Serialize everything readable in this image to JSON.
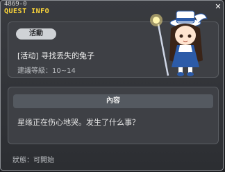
{
  "header": {
    "quest_id": "4869-0",
    "title": "QUEST INFO",
    "close_glyph": "✕"
  },
  "quest": {
    "category_badge": "活動",
    "name": "[活动] 寻找丢失的兔子",
    "level_requirement": "建議等級：10~14"
  },
  "content": {
    "header": "內容",
    "text": "星缘正在伤心地哭。发生了什么事？"
  },
  "footer": {
    "status": "狀態：可開始"
  },
  "colors": {
    "title": "#ffd83a",
    "panel": "#3e4045",
    "badge": "#cfd2d6"
  },
  "icons": [
    "close-icon",
    "npc-portrait"
  ]
}
